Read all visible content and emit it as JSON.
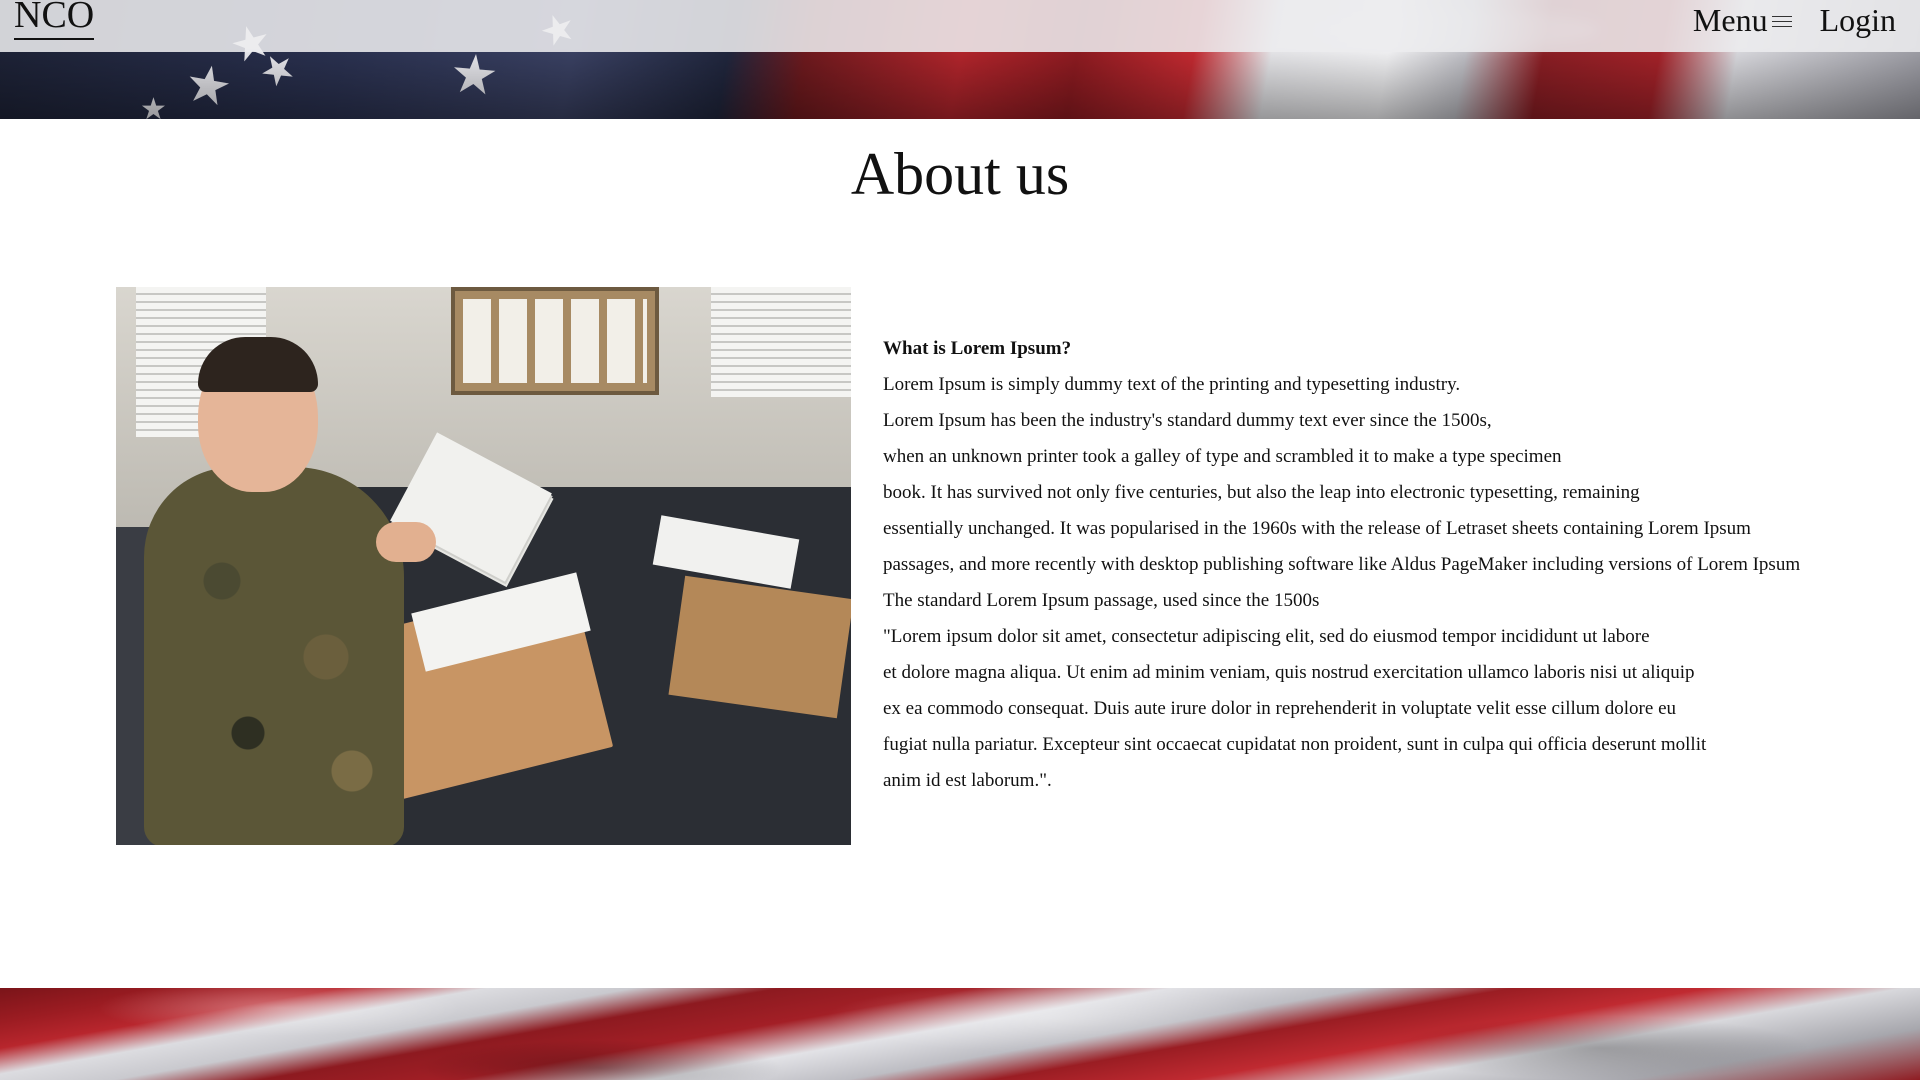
{
  "header": {
    "brand": "NCO",
    "nav": {
      "menu_label": "Menu",
      "login_label": "Login"
    }
  },
  "main": {
    "title": "About us",
    "photo": {
      "description_icon": "soldier-photo"
    },
    "article": {
      "question": "What is Lorem Ipsum?",
      "lines": [
        "Lorem Ipsum is simply dummy text of the printing and typesetting industry.",
        "Lorem Ipsum has been the industry's standard dummy text ever since the 1500s,",
        "when an unknown printer took a galley of type and scrambled it to make a type specimen",
        "book. It has survived not only five centuries, but also the leap into electronic typesetting, remaining",
        "essentially unchanged. It was popularised in the 1960s with the release of Letraset sheets containing Lorem Ipsum",
        "passages, and more recently with desktop publishing software like Aldus PageMaker including versions of Lorem Ipsum",
        "The standard Lorem Ipsum passage, used since the 1500s",
        "\"Lorem ipsum dolor sit amet, consectetur adipiscing elit, sed do eiusmod tempor incididunt ut labore",
        "et dolore magna aliqua. Ut enim ad minim veniam, quis nostrud exercitation ullamco laboris nisi ut aliquip",
        "ex ea commodo consequat. Duis aute irure dolor in reprehenderit in voluptate velit esse cillum dolore eu",
        "fugiat nulla pariatur. Excepteur sint occaecat cupidatat non proident, sunt in culpa qui officia deserunt mollit",
        "anim id est laborum.\"."
      ]
    }
  },
  "colors": {
    "flag_red": "#b3252c",
    "flag_blue": "#1d2236",
    "flag_white": "#e7e7ea",
    "navbar_bg": "#ececee"
  }
}
